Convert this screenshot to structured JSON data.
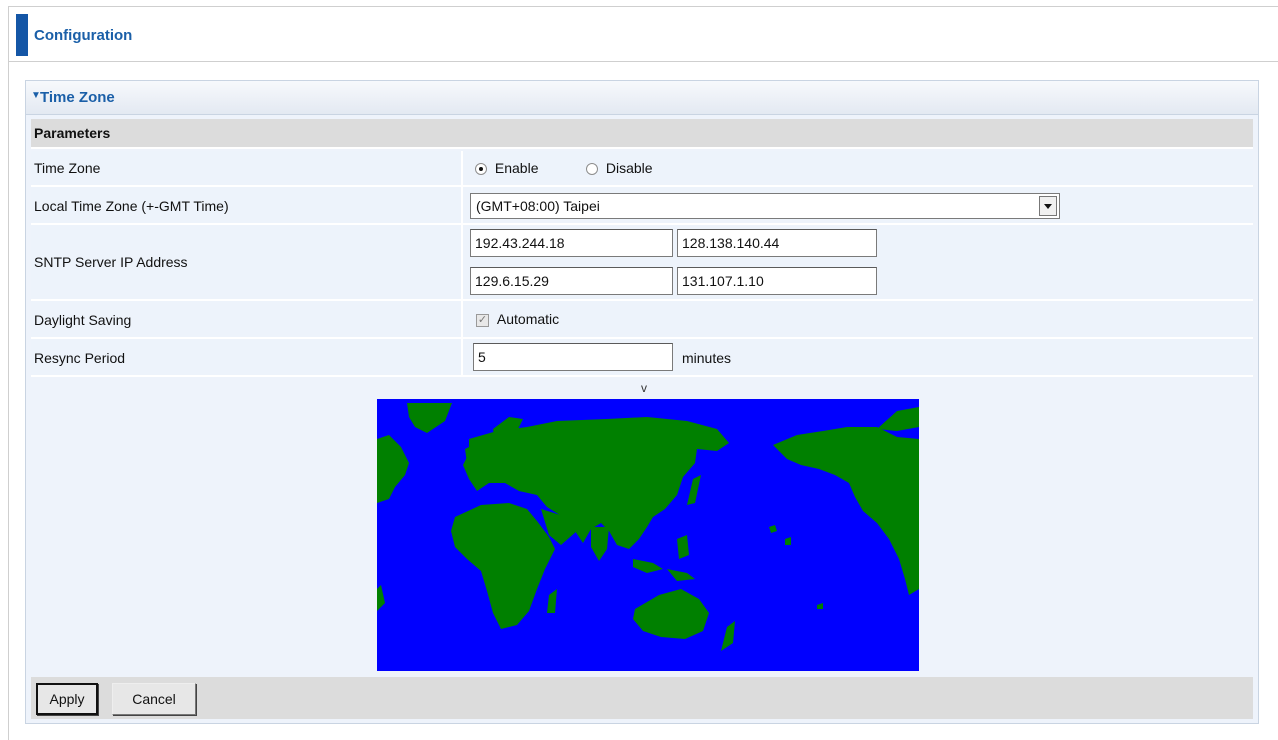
{
  "header": {
    "title": "Configuration"
  },
  "section": {
    "title": "Time Zone"
  },
  "params_title": "Parameters",
  "time_zone": {
    "label": "Time Zone",
    "enable_label": "Enable",
    "disable_label": "Disable",
    "selected": "Enable"
  },
  "local_tz": {
    "label": "Local Time Zone (+-GMT Time)",
    "value": "(GMT+08:00) Taipei"
  },
  "sntp": {
    "label": "SNTP Server IP Address",
    "servers": [
      "192.43.244.18",
      "128.138.140.44",
      "129.6.15.29",
      "131.107.1.10"
    ]
  },
  "daylight": {
    "label": "Daylight Saving",
    "checkbox_label": "Automatic",
    "checked": true
  },
  "resync": {
    "label": "Resync Period",
    "value": "5",
    "unit": "minutes"
  },
  "map": {
    "marker": "v",
    "ocean_color": "#0000ff",
    "land_color": "#008000",
    "icon": "world-map-icon"
  },
  "buttons": {
    "apply": "Apply",
    "cancel": "Cancel"
  },
  "colors": {
    "accent": "#1456a6",
    "title_text": "#1a5fa8",
    "row_bg": "#edf3fb",
    "header_bg": "#dcdcdc"
  }
}
